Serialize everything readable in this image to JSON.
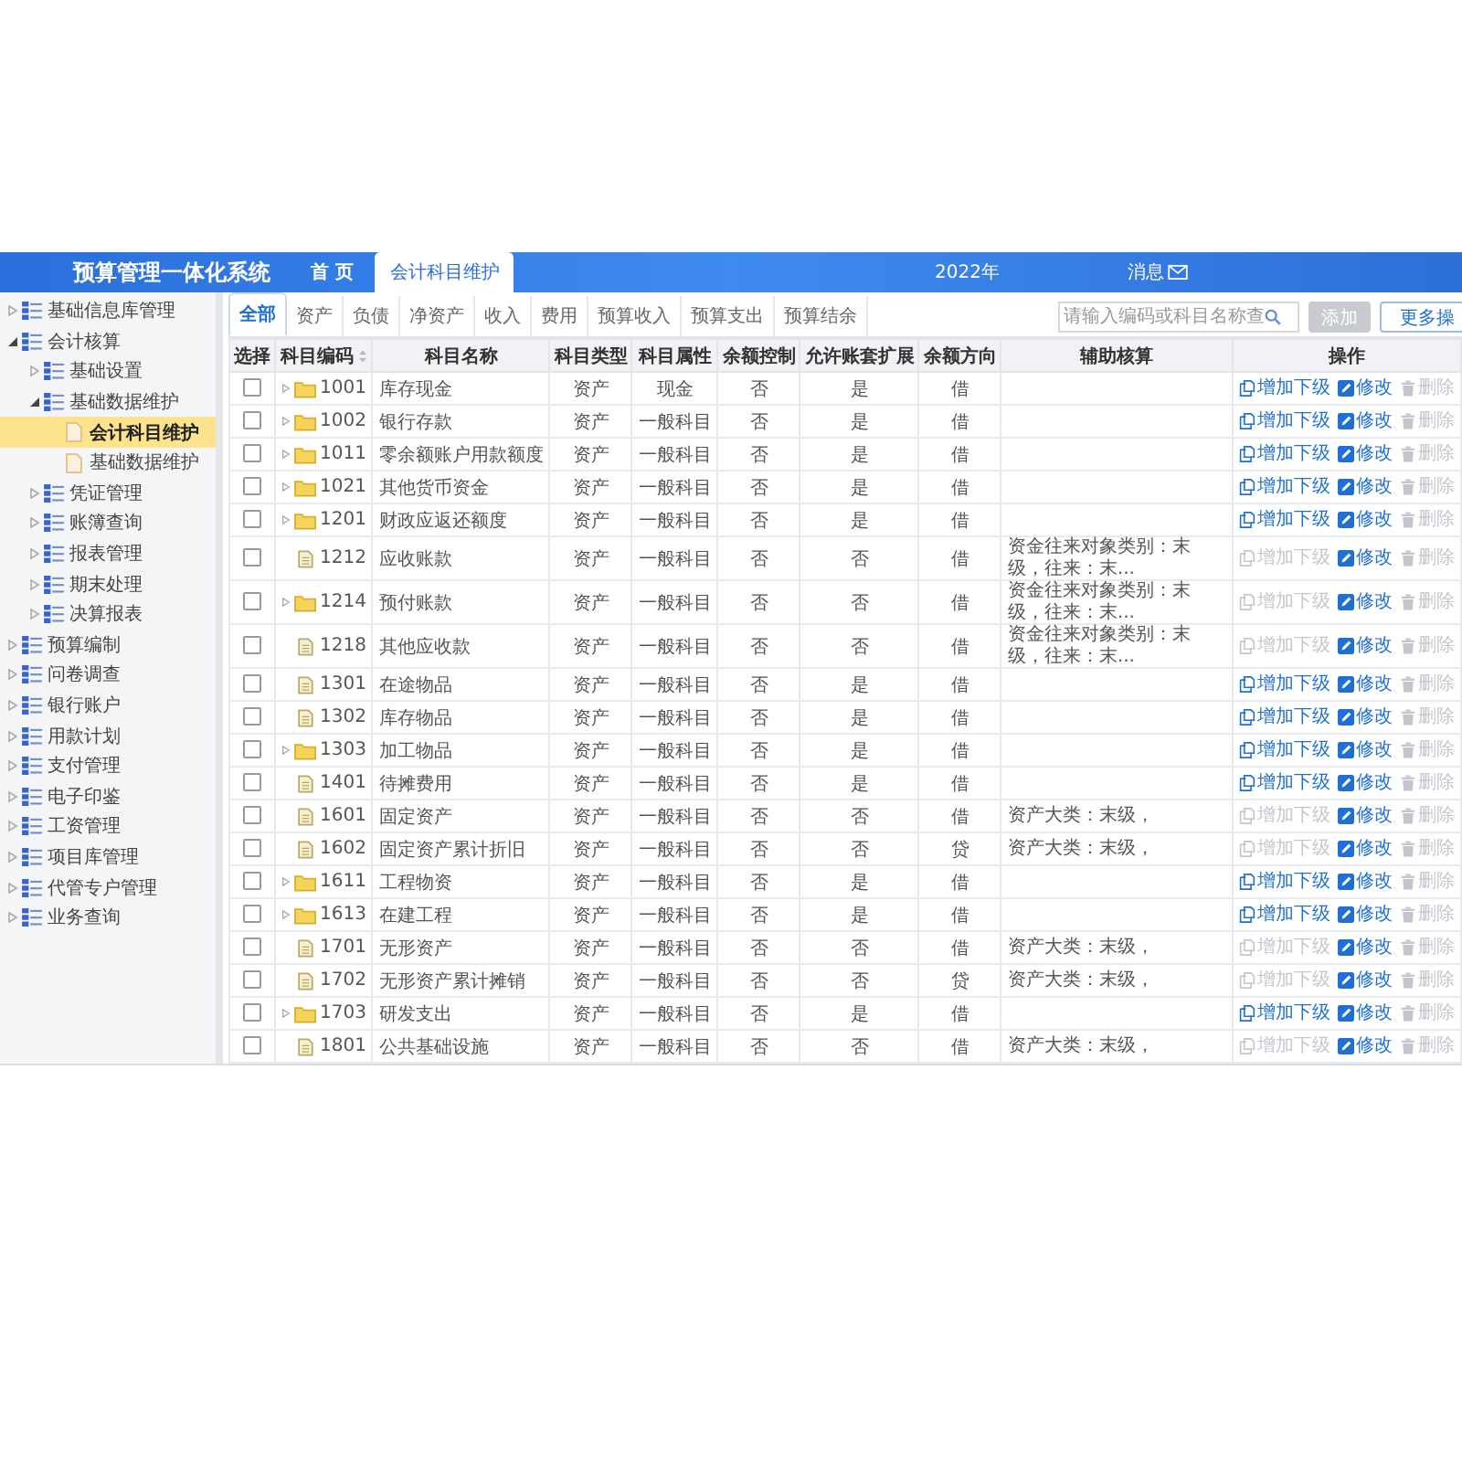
{
  "header": {
    "title": "预算管理一体化系统",
    "tabs": [
      {
        "label": "首 页",
        "selected": false
      },
      {
        "label": "会计科目维护",
        "selected": true
      }
    ],
    "year": "2022年",
    "messages": "消息"
  },
  "sidebar": {
    "items": [
      {
        "kind": "group",
        "label": "基础信息库管理",
        "expanded": false
      },
      {
        "kind": "group",
        "label": "会计核算",
        "expanded": true,
        "children": [
          {
            "kind": "group",
            "label": "基础设置",
            "expanded": false
          },
          {
            "kind": "group",
            "label": "基础数据维护",
            "expanded": true,
            "children": [
              {
                "kind": "page",
                "label": "会计科目维护",
                "selected": true
              },
              {
                "kind": "page",
                "label": "基础数据维护",
                "selected": false
              }
            ]
          },
          {
            "kind": "group",
            "label": "凭证管理",
            "expanded": false
          },
          {
            "kind": "group",
            "label": "账簿查询",
            "expanded": false
          },
          {
            "kind": "group",
            "label": "报表管理",
            "expanded": false
          },
          {
            "kind": "group",
            "label": "期末处理",
            "expanded": false
          },
          {
            "kind": "group",
            "label": "决算报表",
            "expanded": false
          }
        ]
      },
      {
        "kind": "group",
        "label": "预算编制",
        "expanded": false
      },
      {
        "kind": "group",
        "label": "问卷调查",
        "expanded": false
      },
      {
        "kind": "group",
        "label": "银行账户",
        "expanded": false
      },
      {
        "kind": "group",
        "label": "用款计划",
        "expanded": false
      },
      {
        "kind": "group",
        "label": "支付管理",
        "expanded": false
      },
      {
        "kind": "group",
        "label": "电子印鉴",
        "expanded": false
      },
      {
        "kind": "group",
        "label": "工资管理",
        "expanded": false
      },
      {
        "kind": "group",
        "label": "项目库管理",
        "expanded": false
      },
      {
        "kind": "group",
        "label": "代管专户管理",
        "expanded": false
      },
      {
        "kind": "group",
        "label": "业务查询",
        "expanded": false
      }
    ]
  },
  "category_tabs": [
    {
      "label": "全部",
      "selected": true
    },
    {
      "label": "资产",
      "selected": false
    },
    {
      "label": "负债",
      "selected": false
    },
    {
      "label": "净资产",
      "selected": false
    },
    {
      "label": "收入",
      "selected": false
    },
    {
      "label": "费用",
      "selected": false
    },
    {
      "label": "预算收入",
      "selected": false
    },
    {
      "label": "预算支出",
      "selected": false
    },
    {
      "label": "预算结余",
      "selected": false
    }
  ],
  "search": {
    "placeholder": "请输入编码或科目名称查"
  },
  "buttons": [
    {
      "label": "添加",
      "kind": "disabled"
    },
    {
      "label": "更多操",
      "kind": "outline"
    }
  ],
  "table": {
    "columns": [
      "选择",
      "科目编码",
      "科目名称",
      "科目类型",
      "科目属性",
      "余额控制",
      "允许账套扩展",
      "余额方向",
      "辅助核算",
      "操作"
    ],
    "rows": [
      {
        "checked": false,
        "kind": "folder",
        "code": "1001",
        "name": "库存现金",
        "type": "资产",
        "attribute": "现金",
        "balance_control": "否",
        "allow_extend": "是",
        "direction": "借",
        "actions": [
          {
            "kind": "add",
            "label": "增加下级",
            "disabled": false
          },
          {
            "kind": "edit",
            "label": "修改",
            "disabled": false
          },
          {
            "kind": "delete",
            "label": "删除",
            "disabled": true
          }
        ]
      },
      {
        "checked": false,
        "kind": "folder",
        "code": "1002",
        "name": "银行存款",
        "type": "资产",
        "attribute": "一般科目",
        "balance_control": "否",
        "allow_extend": "是",
        "direction": "借",
        "actions": [
          {
            "kind": "add",
            "label": "增加下级",
            "disabled": false
          },
          {
            "kind": "edit",
            "label": "修改",
            "disabled": false
          },
          {
            "kind": "delete",
            "label": "删除",
            "disabled": true
          }
        ]
      },
      {
        "checked": false,
        "kind": "folder",
        "code": "1011",
        "name": "零余额账户用款额度",
        "type": "资产",
        "attribute": "一般科目",
        "balance_control": "否",
        "allow_extend": "是",
        "direction": "借",
        "actions": [
          {
            "kind": "add",
            "label": "增加下级",
            "disabled": false
          },
          {
            "kind": "edit",
            "label": "修改",
            "disabled": false
          },
          {
            "kind": "delete",
            "label": "删除",
            "disabled": true
          }
        ]
      },
      {
        "checked": false,
        "kind": "folder",
        "code": "1021",
        "name": "其他货币资金",
        "type": "资产",
        "attribute": "一般科目",
        "balance_control": "否",
        "allow_extend": "是",
        "direction": "借",
        "actions": [
          {
            "kind": "add",
            "label": "增加下级",
            "disabled": false
          },
          {
            "kind": "edit",
            "label": "修改",
            "disabled": false
          },
          {
            "kind": "delete",
            "label": "删除",
            "disabled": true
          }
        ]
      },
      {
        "checked": false,
        "kind": "folder",
        "code": "1201",
        "name": "财政应返还额度",
        "type": "资产",
        "attribute": "一般科目",
        "balance_control": "否",
        "allow_extend": "是",
        "direction": "借",
        "actions": [
          {
            "kind": "add",
            "label": "增加下级",
            "disabled": false
          },
          {
            "kind": "edit",
            "label": "修改",
            "disabled": false
          },
          {
            "kind": "delete",
            "label": "删除",
            "disabled": true
          }
        ]
      },
      {
        "checked": false,
        "kind": "file",
        "code": "1212",
        "name": "应收账款",
        "type": "资产",
        "attribute": "一般科目",
        "balance_control": "否",
        "allow_extend": "否",
        "direction": "借",
        "auxiliary": "资金往来对象类别：末级，往来：末...",
        "actions": [
          {
            "kind": "add",
            "label": "增加下级",
            "disabled": true
          },
          {
            "kind": "edit",
            "label": "修改",
            "disabled": false
          },
          {
            "kind": "delete",
            "label": "删除",
            "disabled": true
          }
        ]
      },
      {
        "checked": false,
        "kind": "folder",
        "code": "1214",
        "name": "预付账款",
        "type": "资产",
        "attribute": "一般科目",
        "balance_control": "否",
        "allow_extend": "否",
        "direction": "借",
        "auxiliary": "资金往来对象类别：末级，往来：末...",
        "actions": [
          {
            "kind": "add",
            "label": "增加下级",
            "disabled": true
          },
          {
            "kind": "edit",
            "label": "修改",
            "disabled": false
          },
          {
            "kind": "delete",
            "label": "删除",
            "disabled": true
          }
        ]
      },
      {
        "checked": false,
        "kind": "file",
        "code": "1218",
        "name": "其他应收款",
        "type": "资产",
        "attribute": "一般科目",
        "balance_control": "否",
        "allow_extend": "否",
        "direction": "借",
        "auxiliary": "资金往来对象类别：末级，往来：末...",
        "actions": [
          {
            "kind": "add",
            "label": "增加下级",
            "disabled": true
          },
          {
            "kind": "edit",
            "label": "修改",
            "disabled": false
          },
          {
            "kind": "delete",
            "label": "删除",
            "disabled": true
          }
        ]
      },
      {
        "checked": false,
        "kind": "file",
        "code": "1301",
        "name": "在途物品",
        "type": "资产",
        "attribute": "一般科目",
        "balance_control": "否",
        "allow_extend": "是",
        "direction": "借",
        "actions": [
          {
            "kind": "add",
            "label": "增加下级",
            "disabled": false
          },
          {
            "kind": "edit",
            "label": "修改",
            "disabled": false
          },
          {
            "kind": "delete",
            "label": "删除",
            "disabled": true
          }
        ]
      },
      {
        "checked": false,
        "kind": "file",
        "code": "1302",
        "name": "库存物品",
        "type": "资产",
        "attribute": "一般科目",
        "balance_control": "否",
        "allow_extend": "是",
        "direction": "借",
        "actions": [
          {
            "kind": "add",
            "label": "增加下级",
            "disabled": false
          },
          {
            "kind": "edit",
            "label": "修改",
            "disabled": false
          },
          {
            "kind": "delete",
            "label": "删除",
            "disabled": true
          }
        ]
      },
      {
        "checked": false,
        "kind": "folder",
        "code": "1303",
        "name": "加工物品",
        "type": "资产",
        "attribute": "一般科目",
        "balance_control": "否",
        "allow_extend": "是",
        "direction": "借",
        "actions": [
          {
            "kind": "add",
            "label": "增加下级",
            "disabled": false
          },
          {
            "kind": "edit",
            "label": "修改",
            "disabled": false
          },
          {
            "kind": "delete",
            "label": "删除",
            "disabled": true
          }
        ]
      },
      {
        "checked": false,
        "kind": "file",
        "code": "1401",
        "name": "待摊费用",
        "type": "资产",
        "attribute": "一般科目",
        "balance_control": "否",
        "allow_extend": "是",
        "direction": "借",
        "actions": [
          {
            "kind": "add",
            "label": "增加下级",
            "disabled": false
          },
          {
            "kind": "edit",
            "label": "修改",
            "disabled": false
          },
          {
            "kind": "delete",
            "label": "删除",
            "disabled": true
          }
        ]
      },
      {
        "checked": false,
        "kind": "file",
        "code": "1601",
        "name": "固定资产",
        "type": "资产",
        "attribute": "一般科目",
        "balance_control": "否",
        "allow_extend": "否",
        "direction": "借",
        "auxiliary": "资产大类：末级，",
        "actions": [
          {
            "kind": "add",
            "label": "增加下级",
            "disabled": true
          },
          {
            "kind": "edit",
            "label": "修改",
            "disabled": false
          },
          {
            "kind": "delete",
            "label": "删除",
            "disabled": true
          }
        ]
      },
      {
        "checked": false,
        "kind": "file",
        "code": "1602",
        "name": "固定资产累计折旧",
        "type": "资产",
        "attribute": "一般科目",
        "balance_control": "否",
        "allow_extend": "否",
        "direction": "贷",
        "auxiliary": "资产大类：末级，",
        "actions": [
          {
            "kind": "add",
            "label": "增加下级",
            "disabled": true
          },
          {
            "kind": "edit",
            "label": "修改",
            "disabled": false
          },
          {
            "kind": "delete",
            "label": "删除",
            "disabled": true
          }
        ]
      },
      {
        "checked": false,
        "kind": "folder",
        "code": "1611",
        "name": "工程物资",
        "type": "资产",
        "attribute": "一般科目",
        "balance_control": "否",
        "allow_extend": "是",
        "direction": "借",
        "actions": [
          {
            "kind": "add",
            "label": "增加下级",
            "disabled": false
          },
          {
            "kind": "edit",
            "label": "修改",
            "disabled": false
          },
          {
            "kind": "delete",
            "label": "删除",
            "disabled": true
          }
        ]
      },
      {
        "checked": false,
        "kind": "folder",
        "code": "1613",
        "name": "在建工程",
        "type": "资产",
        "attribute": "一般科目",
        "balance_control": "否",
        "allow_extend": "是",
        "direction": "借",
        "actions": [
          {
            "kind": "add",
            "label": "增加下级",
            "disabled": false
          },
          {
            "kind": "edit",
            "label": "修改",
            "disabled": false
          },
          {
            "kind": "delete",
            "label": "删除",
            "disabled": true
          }
        ]
      },
      {
        "checked": false,
        "kind": "file",
        "code": "1701",
        "name": "无形资产",
        "type": "资产",
        "attribute": "一般科目",
        "balance_control": "否",
        "allow_extend": "否",
        "direction": "借",
        "auxiliary": "资产大类：末级，",
        "actions": [
          {
            "kind": "add",
            "label": "增加下级",
            "disabled": true
          },
          {
            "kind": "edit",
            "label": "修改",
            "disabled": false
          },
          {
            "kind": "delete",
            "label": "删除",
            "disabled": true
          }
        ]
      },
      {
        "checked": false,
        "kind": "file",
        "code": "1702",
        "name": "无形资产累计摊销",
        "type": "资产",
        "attribute": "一般科目",
        "balance_control": "否",
        "allow_extend": "否",
        "direction": "贷",
        "auxiliary": "资产大类：末级，",
        "actions": [
          {
            "kind": "add",
            "label": "增加下级",
            "disabled": true
          },
          {
            "kind": "edit",
            "label": "修改",
            "disabled": false
          },
          {
            "kind": "delete",
            "label": "删除",
            "disabled": true
          }
        ]
      },
      {
        "checked": false,
        "kind": "folder",
        "code": "1703",
        "name": "研发支出",
        "type": "资产",
        "attribute": "一般科目",
        "balance_control": "否",
        "allow_extend": "是",
        "direction": "借",
        "actions": [
          {
            "kind": "add",
            "label": "增加下级",
            "disabled": false
          },
          {
            "kind": "edit",
            "label": "修改",
            "disabled": false
          },
          {
            "kind": "delete",
            "label": "删除",
            "disabled": true
          }
        ]
      },
      {
        "checked": false,
        "kind": "file",
        "code": "1801",
        "name": "公共基础设施",
        "type": "资产",
        "attribute": "一般科目",
        "balance_control": "否",
        "allow_extend": "否",
        "direction": "借",
        "auxiliary": "资产大类：末级，",
        "actions": [
          {
            "kind": "add",
            "label": "增加下级",
            "disabled": true
          },
          {
            "kind": "edit",
            "label": "修改",
            "disabled": false
          },
          {
            "kind": "delete",
            "label": "删除",
            "disabled": true
          }
        ]
      }
    ]
  }
}
